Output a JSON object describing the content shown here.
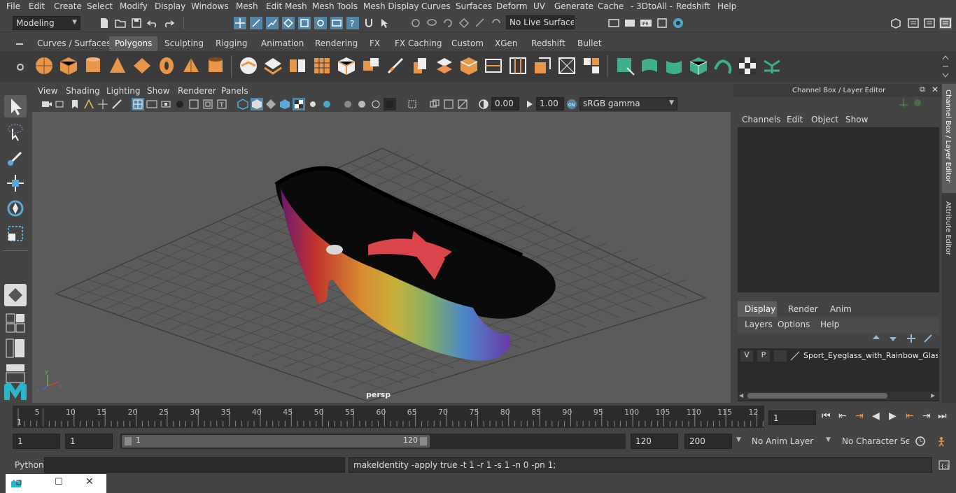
{
  "menubar": {
    "items": [
      "File",
      "Edit",
      "Create",
      "Select",
      "Modify",
      "Display",
      "Windows",
      "Mesh",
      "Edit Mesh",
      "Mesh Tools",
      "Mesh Display",
      "Curves",
      "Surfaces",
      "Deform",
      "UV",
      "Generate",
      "Cache",
      "- 3DtoAll -",
      "Redshift",
      "Help"
    ]
  },
  "status": {
    "mode": "Modeling",
    "live_surface": "No Live Surface"
  },
  "shelf": {
    "tabs": [
      "Curves / Surfaces",
      "Polygons",
      "Sculpting",
      "Rigging",
      "Animation",
      "Rendering",
      "FX",
      "FX Caching",
      "Custom",
      "XGen",
      "Redshift",
      "Bullet"
    ],
    "active_tab": "Polygons"
  },
  "viewport": {
    "menus": [
      "View",
      "Shading",
      "Lighting",
      "Show",
      "Renderer",
      "Panels"
    ],
    "exposure": "0.00",
    "gamma": "1.00",
    "color_space": "sRGB gamma",
    "camera_label": "persp"
  },
  "channel_box": {
    "title": "Channel Box / Layer Editor",
    "menus": [
      "Channels",
      "Edit",
      "Object",
      "Show"
    ],
    "layer_tabs": [
      "Display",
      "Render",
      "Anim"
    ],
    "active_layer_tab": "Display",
    "layer_menus": [
      "Layers",
      "Options",
      "Help"
    ],
    "layer": {
      "v": "V",
      "p": "P",
      "name": "Sport_Eyeglass_with_Rainbow_Glasses"
    }
  },
  "side_tabs": [
    "Channel Box / Layer Editor",
    "Attribute Editor"
  ],
  "timeline": {
    "ticks": [
      "5",
      "10",
      "15",
      "20",
      "25",
      "30",
      "35",
      "40",
      "45",
      "50",
      "55",
      "60",
      "65",
      "70",
      "75",
      "80",
      "85",
      "90",
      "95",
      "100",
      "105",
      "110",
      "115",
      "12"
    ],
    "start_marker": "1",
    "current_frame": "1"
  },
  "range": {
    "start": "1",
    "anim_start": "1",
    "slider_start": "1",
    "slider_end": "120",
    "anim_end": "120",
    "end": "200",
    "anim_layer": "No Anim Layer",
    "character_set": "No Character Set"
  },
  "command": {
    "language": "Python",
    "input": "",
    "result": "makeIdentity -apply true -t 1 -r 1 -s 1 -n 0 -pn 1;"
  },
  "colors": {
    "accent_blue": "#5285a6",
    "shelf_orange": "#e8964a",
    "shelf_green": "#3fae8c",
    "viewport_bg": "#5b5b5b"
  }
}
